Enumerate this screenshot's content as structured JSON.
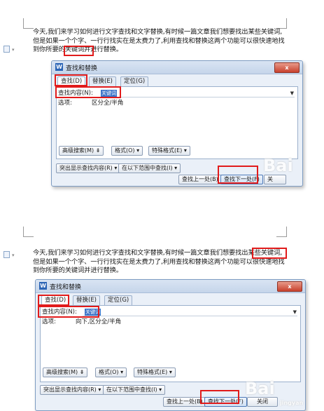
{
  "panels": [
    {
      "paragraph": {
        "line1": "今天,我们来学习如何进行文字查找和文字替换,有时候一篇文章我们想要找出某些关键词,",
        "line2": "但是如果一个个字、一行行找实在是太费力了,利用查找和替换这两个功能可以很快速地找",
        "line3": "到你所要的关键词并进行替换。"
      },
      "dialog": {
        "title": "查找和替换",
        "close_label": "x",
        "tabs": [
          "查找(D)",
          "替换(E)",
          "定位(G)"
        ],
        "find_label": "查找内容(N):",
        "find_value": "关键词",
        "options_label": "选项:",
        "options_value": "区分全/半角",
        "advanced_search_label": "高级搜索(M) ⇟",
        "format_label": "格式(O) ▾",
        "special_format_label": "特殊格式(E) ▾",
        "highlight_label": "突出显示查找内容(R) ▾",
        "find_in_label": "在以下范围中查找(I) ▾",
        "find_prev_label": "查找上一处(B)",
        "find_next_label": "查找下一处(F)",
        "close_button_label": "关"
      }
    },
    {
      "paragraph": {
        "line1": "今天,我们来学习如何进行文字查找和文字替换,有时候一篇文章我们想要找出某些关键词,",
        "line2": "但是如果一个个字、一行行找实在是太费力了,利用查找和替换这两个功能可以很快速地找",
        "line3": "到你所要的关键词并进行替换。"
      },
      "dialog": {
        "title": "查找和替换",
        "close_label": "x",
        "tabs": [
          "查找(D)",
          "替换(E)",
          "定位(G)"
        ],
        "find_label": "查找内容(N):",
        "find_value": "关键词",
        "options_label": "选项:",
        "options_value": "向下,区分全/半角",
        "advanced_search_label": "高级搜索(M) ⇟",
        "format_label": "格式(O) ▾",
        "special_format_label": "特殊格式(E) ▾",
        "highlight_label": "突出显示查找内容(R) ▾",
        "find_in_label": "在以下范围中查找(I) ▾",
        "find_prev_label": "查找上一处(B)",
        "find_next_label": "查找下一处(F)",
        "close_button_label": "关闭"
      }
    }
  ],
  "watermark": {
    "brand": "Bai",
    "sub": "jingyan"
  },
  "colors": {
    "annotation_red": "#e11b1b",
    "selection_blue": "#3b73c8",
    "dialog_bg": "#eaf0f8"
  }
}
